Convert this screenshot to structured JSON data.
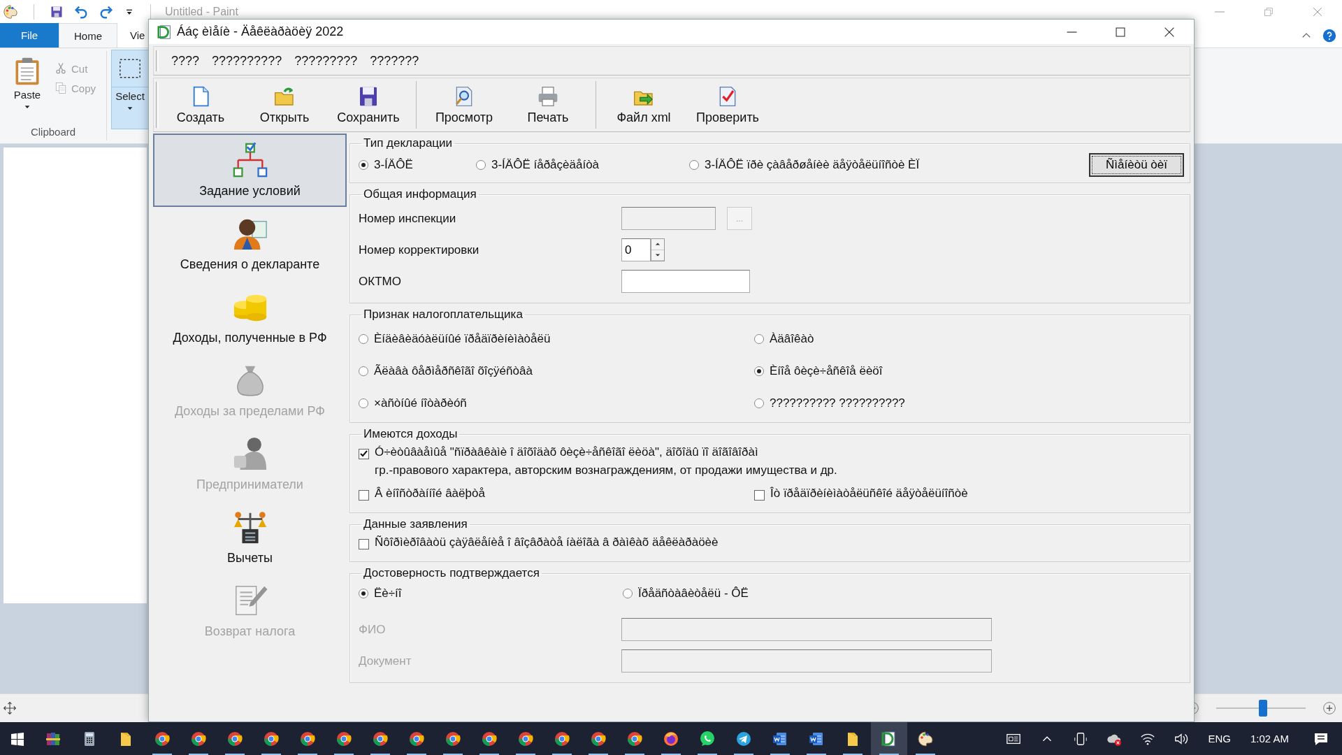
{
  "paint": {
    "title": "Untitled - Paint",
    "tabs": [
      {
        "label": "File",
        "selected": false,
        "kind": "file"
      },
      {
        "label": "Home",
        "selected": true,
        "kind": "tab"
      },
      {
        "label": "Vie",
        "selected": false,
        "kind": "tab"
      }
    ],
    "clipboard": {
      "paste": "Paste",
      "cut": "Cut",
      "copy": "Copy",
      "group": "Clipboard"
    },
    "select": "Select",
    "zoom_slider": {
      "level": 0.52
    }
  },
  "dialog": {
    "title": "Ááç èìåíè - Äåêëàðàöèÿ 2022",
    "menu": [
      "????",
      "??????????",
      "?????????",
      "???????"
    ],
    "toolbar": [
      {
        "label": "Создать",
        "kind": "new",
        "separator_before": false
      },
      {
        "label": "Открыть",
        "kind": "open",
        "separator_before": false
      },
      {
        "label": "Сохранить",
        "kind": "save",
        "separator_before": false
      },
      {
        "label": "Просмотр",
        "kind": "preview",
        "separator_before": true
      },
      {
        "label": "Печать",
        "kind": "print",
        "separator_before": false
      },
      {
        "label": "Файл xml",
        "kind": "xml",
        "separator_before": true
      },
      {
        "label": "Проверить",
        "kind": "check",
        "separator_before": false
      }
    ],
    "nav": [
      {
        "label": "Задание условий",
        "kind": "conditions",
        "selected": true,
        "disabled": false
      },
      {
        "label": "Сведения о декларанте",
        "kind": "declarant",
        "selected": false,
        "disabled": false
      },
      {
        "label": "Доходы, полученные в РФ",
        "kind": "income",
        "selected": false,
        "disabled": false
      },
      {
        "label": "Доходы за пределами РФ",
        "kind": "abroad",
        "selected": false,
        "disabled": true
      },
      {
        "label": "Предприниматели",
        "kind": "business",
        "selected": false,
        "disabled": true
      },
      {
        "label": "Вычеты",
        "kind": "deductions",
        "selected": false,
        "disabled": false
      },
      {
        "label": "Возврат налога",
        "kind": "refund",
        "selected": false,
        "disabled": true
      }
    ],
    "sections": [
      {
        "kind": "declaration_type",
        "title": "Тип декларации",
        "options": [
          {
            "label": "3-ÍÄÔË",
            "selected": true
          },
          {
            "label": "3-ÍÄÔË íåðåçèäåíòà",
            "selected": false
          },
          {
            "label": "3-ÍÄÔË ïðè çàâåðøåíèè äåÿòåëüíîñòè ÈÏ",
            "selected": false
          }
        ],
        "button": "Ñìåíèòü òèï"
      },
      {
        "kind": "general",
        "title": "Общая информация",
        "fields": [
          {
            "label": "Номер инспекции",
            "kind": "picker",
            "readonly": true,
            "button": "..."
          },
          {
            "label": "Номер корректировки",
            "kind": "spin",
            "value": "0"
          },
          {
            "label": "ОКТМО",
            "kind": "text"
          }
        ]
      },
      {
        "kind": "taxpayer",
        "title": "Признак налогоплательщика",
        "options": [
          {
            "label": "Èíäèâèäóàëüíûé ïðåäïðèíèìàòåëü",
            "selected": false
          },
          {
            "label": "Àäâîêàò",
            "selected": false
          },
          {
            "label": "Ãëàâà ôåðìåðñêîãî õîçÿéñòâà",
            "selected": false
          },
          {
            "label": "Èíîå ôèçè÷åñêîå ëèöî",
            "selected": true
          },
          {
            "label": "×àñòíûé íîòàðèóñ",
            "selected": false
          },
          {
            "label": "?????????? ??????????",
            "selected": false
          }
        ]
      },
      {
        "kind": "income",
        "title": "Имеются доходы",
        "checks": [
          {
            "label": "Ó÷èòûâàåìûå \"ñïðàâêàìè î äîõîäàõ ôèçè÷åñêîãî ëèöà\", äîõîäû ïî äîãîâîðàì\nгр.-правового характера, авторским вознаграждениям, от продажи имущества и др.",
            "checked": true,
            "kind": "wide"
          },
          {
            "label": "Â èíîñòðàííîé âàëþòå",
            "checked": false,
            "kind": "half"
          },
          {
            "label": "Îò ïðåäïðèíèìàòåëüñêîé äåÿòåëüíîñòè",
            "checked": false,
            "kind": "half"
          }
        ]
      },
      {
        "kind": "application",
        "title": "Данные заявления",
        "checks": [
          {
            "label": "Ñôîðìèðîâàòü çàÿâëåíèå î âîçâðàòå íàëîãà â ðàìêàõ äåêëàðàöèè",
            "checked": false,
            "kind": "wide"
          }
        ]
      },
      {
        "kind": "signer",
        "title": "Достоверность подтверждается",
        "options": [
          {
            "label": "Ëè÷íî",
            "selected": true
          },
          {
            "label": "Ïðåäñòàâèòåëü - ÔË",
            "selected": false
          }
        ],
        "fields": [
          {
            "label": "ФИО",
            "kind": "text",
            "disabled": true
          },
          {
            "label": "Документ",
            "kind": "text",
            "disabled": true
          }
        ]
      }
    ]
  },
  "taskbar": {
    "apps": [
      {
        "kind": "start",
        "selected": false,
        "running": false
      },
      {
        "kind": "archiver",
        "selected": false,
        "running": false
      },
      {
        "kind": "calculator",
        "selected": false,
        "running": false
      },
      {
        "kind": "folder",
        "selected": false,
        "running": false
      },
      {
        "kind": "chrome",
        "selected": false,
        "running": true
      },
      {
        "kind": "chrome",
        "selected": false,
        "running": true
      },
      {
        "kind": "chrome",
        "selected": false,
        "running": true
      },
      {
        "kind": "chrome",
        "selected": false,
        "running": true
      },
      {
        "kind": "chrome",
        "selected": false,
        "running": true
      },
      {
        "kind": "chrome",
        "selected": false,
        "running": true
      },
      {
        "kind": "chrome",
        "selected": false,
        "running": true
      },
      {
        "kind": "chrome",
        "selected": false,
        "running": true
      },
      {
        "kind": "chrome",
        "selected": false,
        "running": true
      },
      {
        "kind": "chrome",
        "selected": false,
        "running": true
      },
      {
        "kind": "chrome",
        "selected": false,
        "running": true
      },
      {
        "kind": "chrome",
        "selected": false,
        "running": true
      },
      {
        "kind": "chrome",
        "selected": false,
        "running": true
      },
      {
        "kind": "chrome",
        "selected": false,
        "running": true
      },
      {
        "kind": "firefox",
        "selected": false,
        "running": true
      },
      {
        "kind": "whatsapp",
        "selected": false,
        "running": true
      },
      {
        "kind": "telegram",
        "selected": false,
        "running": true
      },
      {
        "kind": "word",
        "selected": false,
        "running": true
      },
      {
        "kind": "word",
        "selected": false,
        "running": true
      },
      {
        "kind": "folder",
        "selected": false,
        "running": true
      },
      {
        "kind": "declaration",
        "selected": true,
        "running": true
      },
      {
        "kind": "paint",
        "selected": false,
        "running": true
      }
    ],
    "language": "ENG",
    "time": "1:02 AM"
  }
}
